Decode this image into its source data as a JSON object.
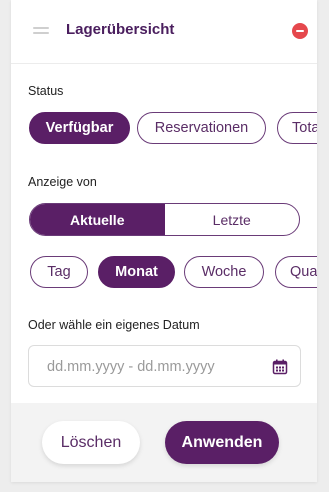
{
  "header": {
    "title": "Lagerübersicht"
  },
  "status": {
    "label": "Status",
    "options": [
      {
        "label": "Verfügbar",
        "active": true
      },
      {
        "label": "Reservationen",
        "active": false
      },
      {
        "label": "Tota",
        "active": false
      }
    ]
  },
  "display": {
    "label": "Anzeige von",
    "segments": [
      {
        "label": "Aktuelle",
        "active": true
      },
      {
        "label": "Letzte",
        "active": false
      }
    ]
  },
  "period": {
    "options": [
      {
        "label": "Tag",
        "active": false
      },
      {
        "label": "Monat",
        "active": true
      },
      {
        "label": "Woche",
        "active": false
      },
      {
        "label": "Qua",
        "active": false
      }
    ]
  },
  "custom_date": {
    "label": "Oder wähle ein eigenes Datum",
    "placeholder": "dd.mm.yyyy - dd.mm.yyyy",
    "value": ""
  },
  "footer": {
    "clear_label": "Löschen",
    "apply_label": "Anwenden"
  },
  "colors": {
    "accent": "#5a1f66",
    "close": "#e5484d"
  },
  "icons": {
    "handle": "drag-handle-icon",
    "close": "minus-circle-icon",
    "calendar": "calendar-icon"
  }
}
